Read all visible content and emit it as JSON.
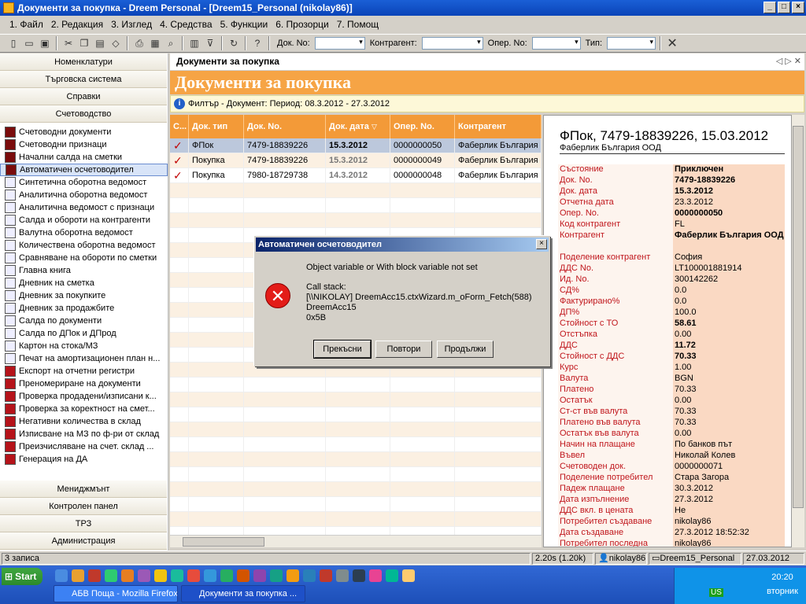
{
  "window": {
    "title": "Документи за покупка - Dreem Personal - [Dreem15_Personal (nikolay86)]"
  },
  "menu": [
    "1. Файл",
    "2. Редакция",
    "3. Изглед",
    "4. Средства",
    "5. Функции",
    "6. Прозорци",
    "7. Помощ"
  ],
  "toolbar": {
    "doc_label": "Док. No:",
    "partner_label": "Контрагент:",
    "oper_label": "Опер. No:",
    "type_label": "Тип:"
  },
  "sidebar": {
    "top_sections": [
      "Номенклатури",
      "Търговска система",
      "Справки",
      "Счетоводство"
    ],
    "items": [
      {
        "label": "Счетоводни документи",
        "icon": "acc"
      },
      {
        "label": "Счетоводни признаци",
        "icon": "acc"
      },
      {
        "label": "Начални салда на сметки",
        "icon": "acc"
      },
      {
        "label": "Автоматичен осчетоводител",
        "icon": "acc"
      },
      {
        "label": "Синтетична оборотна ведомост",
        "icon": "ref"
      },
      {
        "label": "Аналитична оборотна ведомост",
        "icon": "ref"
      },
      {
        "label": "Аналитична ведомост с признаци",
        "icon": "ref"
      },
      {
        "label": "Салда и обороти на контрагенти",
        "icon": "ref"
      },
      {
        "label": "Валутна оборотна ведомост",
        "icon": "ref"
      },
      {
        "label": "Количествена оборотна ведомост",
        "icon": "ref"
      },
      {
        "label": "Сравняване на обороти по сметки",
        "icon": "ref"
      },
      {
        "label": "Главна книга",
        "icon": "ref"
      },
      {
        "label": "Дневник на сметка",
        "icon": "ref"
      },
      {
        "label": "Дневник за покупките",
        "icon": "ref"
      },
      {
        "label": "Дневник за продажбите",
        "icon": "ref"
      },
      {
        "label": "Салда по документи",
        "icon": "ref"
      },
      {
        "label": "Салда по ДПок и ДПрод",
        "icon": "ref"
      },
      {
        "label": "Картон на стока/МЗ",
        "icon": "ref"
      },
      {
        "label": "Печат на амортизационен план н...",
        "icon": "ref"
      },
      {
        "label": "Експорт на отчетни регистри",
        "icon": "pr"
      },
      {
        "label": "Преномериране на документи",
        "icon": "pr"
      },
      {
        "label": "Проверка продадени/изписани к...",
        "icon": "pr"
      },
      {
        "label": "Проверка за коректност на смет...",
        "icon": "pr"
      },
      {
        "label": "Негативни количества в склад",
        "icon": "pr"
      },
      {
        "label": "Изписване на МЗ по ф-ри от склад",
        "icon": "pr"
      },
      {
        "label": "Преизчисляване на счет. склад ...",
        "icon": "pr"
      },
      {
        "label": "Генерация на ДА",
        "icon": "pr"
      }
    ],
    "selected_index": 3,
    "bottom_sections": [
      "Мениджмънт",
      "Контролен панел",
      "ТРЗ",
      "Администрация"
    ]
  },
  "tab": {
    "label": "Документи за покупка"
  },
  "page": {
    "title": "Документи за покупка",
    "filter": "Филтър - Документ: Период: 08.3.2012 - 27.3.2012"
  },
  "grid": {
    "columns": [
      "С...",
      "Док. тип",
      "Док. No.",
      "Док. дата",
      "Опер. No.",
      "Контрагент"
    ],
    "rows": [
      {
        "check": "✓",
        "type": "ФПок",
        "doc_no": "7479-18839226",
        "date": "15.3.2012",
        "oper": "0000000050",
        "partner": "Фаберлик България ООД"
      },
      {
        "check": "✓",
        "type": "Покупка",
        "doc_no": "7479-18839226",
        "date": "15.3.2012",
        "oper": "0000000049",
        "partner": "Фаберлик България ООД"
      },
      {
        "check": "✓",
        "type": "Покупка",
        "doc_no": "7980-18729738",
        "date": "14.3.2012",
        "oper": "0000000048",
        "partner": "Фаберлик България ООД"
      }
    ]
  },
  "details": {
    "title": "ФПок, 7479-18839226, 15.03.2012",
    "subtitle": "Фаберлик България ООД",
    "rows": [
      {
        "k": "Състояние",
        "v": "Приключен",
        "b": true
      },
      {
        "k": "Док. No.",
        "v": "7479-18839226",
        "b": true
      },
      {
        "k": "Док. дата",
        "v": "15.3.2012",
        "b": true
      },
      {
        "k": "Отчетна дата",
        "v": "23.3.2012",
        "b": false
      },
      {
        "k": "Опер. No.",
        "v": "0000000050",
        "b": true
      },
      {
        "k": "Код контрагент",
        "v": "FL",
        "b": false
      },
      {
        "k": "Контрагент",
        "v": "Фаберлик България ООД",
        "b": true
      },
      {
        "k": "Поделение контрагент",
        "v": "София",
        "b": false
      },
      {
        "k": "ДДС No.",
        "v": "LT100001881914",
        "b": false
      },
      {
        "k": "Ид. No.",
        "v": "300142262",
        "b": false
      },
      {
        "k": "СД%",
        "v": "0.0",
        "b": false
      },
      {
        "k": "Фактурирано%",
        "v": "0.0",
        "b": false
      },
      {
        "k": "ДП%",
        "v": "100.0",
        "b": false
      },
      {
        "k": "Стойност с ТО",
        "v": "58.61",
        "b": true
      },
      {
        "k": "Отстъпка",
        "v": "0.00",
        "b": false
      },
      {
        "k": "ДДС",
        "v": "11.72",
        "b": true
      },
      {
        "k": "Стойност с ДДС",
        "v": "70.33",
        "b": true
      },
      {
        "k": "Курс",
        "v": "1.00",
        "b": false
      },
      {
        "k": "Валута",
        "v": "BGN",
        "b": false
      },
      {
        "k": "Платено",
        "v": "70.33",
        "b": false
      },
      {
        "k": "Остатък",
        "v": "0.00",
        "b": false
      },
      {
        "k": "Ст-ст във валута",
        "v": "70.33",
        "b": false
      },
      {
        "k": "Платено във валута",
        "v": "70.33",
        "b": false
      },
      {
        "k": "Остатък във валута",
        "v": "0.00",
        "b": false
      },
      {
        "k": "Начин на плащане",
        "v": "По банков път",
        "b": false
      },
      {
        "k": "Въвел",
        "v": "Николай Колев",
        "b": false
      },
      {
        "k": "Счетоводен док.",
        "v": "0000000071",
        "b": false
      },
      {
        "k": "Поделение потребител",
        "v": "Стара Загора",
        "b": false
      },
      {
        "k": "Падеж плащане",
        "v": "30.3.2012",
        "b": false
      },
      {
        "k": "Дата изпълнение",
        "v": "27.3.2012",
        "b": false
      },
      {
        "k": "ДДС вкл. в цената",
        "v": "Не",
        "b": false
      },
      {
        "k": "Потребител създаване",
        "v": "nikolay86",
        "b": false
      },
      {
        "k": "Дата създаване",
        "v": "27.3.2012 18:52:32",
        "b": false
      },
      {
        "k": "Потребител последна",
        "v": "nikolay86",
        "b": false
      }
    ]
  },
  "dialog": {
    "title": "Автоматичен осчетоводител",
    "message": "Object variable or With block variable not set",
    "stack_label": "Call stack:",
    "stack_line1": "[\\\\NIKOLAY] DreemAcc15.ctxWizard.m_oForm_Fetch(588)",
    "stack_line2": "DreemAcc15",
    "stack_line3": "0x5B",
    "abort": "Прекъсни",
    "retry": "Повтори",
    "continue": "Продължи"
  },
  "status": {
    "records": "3 записа",
    "timing": "2.20s (1.20k)",
    "user": "nikolay86",
    "db": "Dreem15_Personal",
    "date": "27.03.2012"
  },
  "taskbar": {
    "start": "Start",
    "tasks": [
      "АБВ Поща - Mozilla Firefox",
      "Документи за покупка ..."
    ],
    "time": "20:20",
    "day": "вторник",
    "lang": "US"
  },
  "colors": {
    "accent": "#f39a38",
    "title_bg": "#f6a445",
    "selected_row": "#bcc8dc"
  }
}
